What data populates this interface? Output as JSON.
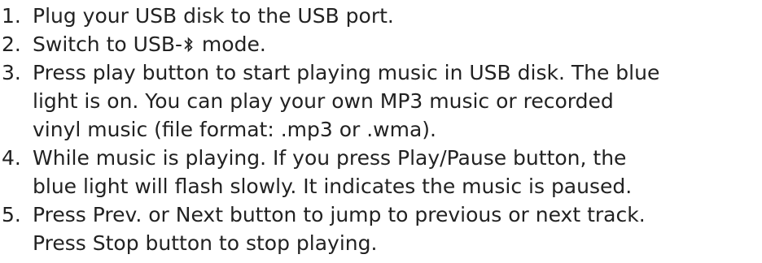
{
  "steps": [
    {
      "number": "1.",
      "lines": [
        "Plug your USB disk to the USB port."
      ]
    },
    {
      "number": "2.",
      "prefix": "Switch to USB-",
      "icon": "bluetooth-icon",
      "suffix": " mode."
    },
    {
      "number": "3.",
      "lines": [
        "Press play button to start playing music in USB disk. The blue",
        "light is on. You can play your own MP3 music or recorded",
        "vinyl music (file format: .mp3 or .wma)."
      ]
    },
    {
      "number": "4.",
      "lines": [
        "While music is playing. If you press Play/Pause button, the",
        "blue light will flash slowly. It indicates the music is paused."
      ]
    },
    {
      "number": "5.",
      "lines": [
        "Press Prev. or Next button to jump to previous or next track.",
        "Press Stop button to stop playing."
      ]
    }
  ]
}
